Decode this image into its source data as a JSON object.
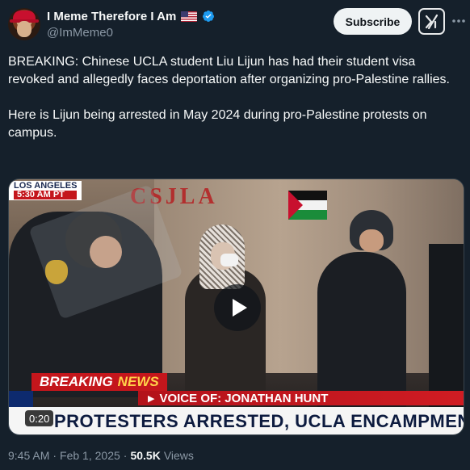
{
  "author": {
    "display_name": "I Meme Therefore I Am",
    "handle": "@ImMeme0",
    "flag_icon": "us-flag-icon",
    "verified_icon": "verified-badge-icon",
    "verified_color": "#1d9bf0"
  },
  "actions": {
    "subscribe_label": "Subscribe",
    "grok_icon": "grok-icon",
    "more_icon": "more-options-icon"
  },
  "tweet": {
    "text": "BREAKING: Chinese UCLA student Liu Lijun has had their student visa revoked and allegedly faces deportation after organizing pro-Palestine rallies.\n\nHere is Lijun being arrested in May 2024 during pro-Palestine protests on campus."
  },
  "video": {
    "duration": "0:20",
    "play_icon": "play-icon",
    "overlay": {
      "location_top": "LOS ANGELES",
      "location_time": "5:30 AM PT",
      "graffiti": "CSJLA",
      "breaking_word": "BREAKING",
      "news_word": "NEWS",
      "voice_of": "VOICE OF: JONATHAN HUNT",
      "headline": "PROTESTERS ARRESTED, UCLA ENCAMPMENT DISMANTLED"
    }
  },
  "meta": {
    "time": "9:45 AM",
    "separator": "·",
    "date": "Feb 1, 2025",
    "views_count": "50.5K",
    "views_label": "Views"
  },
  "colors": {
    "background": "#15202b",
    "text_primary": "#f7f9f9",
    "text_secondary": "#8b98a5",
    "breaking_red": "#c4161c"
  }
}
